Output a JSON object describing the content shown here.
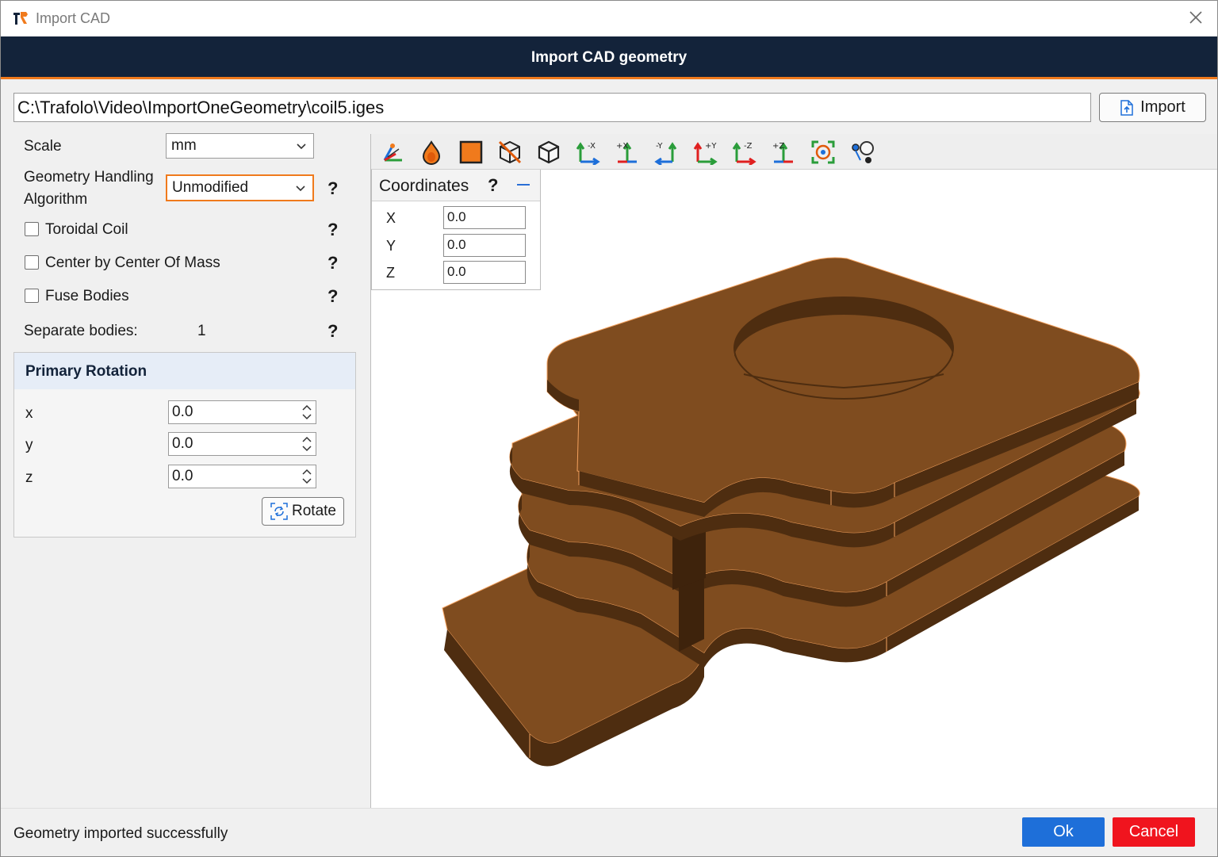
{
  "window": {
    "title": "Import CAD"
  },
  "header": {
    "title": "Import CAD geometry"
  },
  "path": {
    "value": "C:\\Trafolo\\Video\\ImportOneGeometry\\coil5.iges"
  },
  "import_button": {
    "label": "Import"
  },
  "settings": {
    "scale_label": "Scale",
    "scale_value": "mm",
    "algorithm_label_line1": "Geometry Handling",
    "algorithm_label_line2": "Algorithm",
    "algorithm_value": "Unmodified",
    "toroidal_label": "Toroidal Coil",
    "toroidal_checked": false,
    "center_label": "Center by Center Of Mass",
    "center_checked": false,
    "fuse_label": "Fuse Bodies",
    "fuse_checked": false,
    "separate_label": "Separate bodies:",
    "separate_value": "1",
    "help_mark": "?"
  },
  "rotation": {
    "title": "Primary Rotation",
    "x_label": "x",
    "x_value": "0.0",
    "y_label": "y",
    "y_value": "0.0",
    "z_label": "z",
    "z_value": "0.0",
    "rotate_label": "Rotate"
  },
  "toolbar": {
    "icons": [
      "axes-view-icon",
      "color-drop-icon",
      "solid-shading-icon",
      "hide-geometry-icon",
      "box-view-icon",
      "view-minus-x-icon",
      "view-plus-x-icon",
      "view-minus-y-icon",
      "view-plus-y-icon",
      "view-minus-z-icon",
      "view-plus-z-icon",
      "fit-view-icon",
      "point-select-icon"
    ],
    "axis_labels": {
      "mx": "-X",
      "px": "+X",
      "my": "-Y",
      "py": "+Y",
      "mz": "-Z",
      "pz": "+Z"
    }
  },
  "coordinates": {
    "title": "Coordinates",
    "help": "?",
    "x_label": "X",
    "x_value": "0.0",
    "y_label": "Y",
    "y_value": "0.0",
    "z_label": "Z",
    "z_value": "0.0"
  },
  "status": {
    "text": "Geometry imported successfully"
  },
  "buttons": {
    "ok": "Ok",
    "cancel": "Cancel"
  },
  "colors": {
    "header_bg": "#13233a",
    "accent": "#f07a1c",
    "copper_top": "#7f4c1f",
    "copper_side": "#4e2d10",
    "ok": "#1e6fd9",
    "cancel": "#f0141e"
  }
}
